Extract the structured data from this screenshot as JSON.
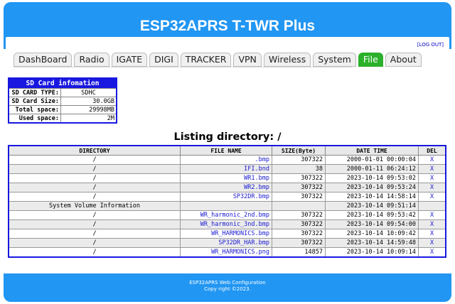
{
  "app": {
    "title": "ESP32APRS T-TWR Plus",
    "logout": "[LOG OUT]"
  },
  "tabs": [
    "DashBoard",
    "Radio",
    "IGATE",
    "DIGI",
    "TRACKER",
    "VPN",
    "Wireless",
    "System",
    "File",
    "About"
  ],
  "active_tab": "File",
  "sdcard": {
    "heading": "SD Card infomation",
    "rows": [
      {
        "label": "SD CARD TYPE:",
        "value": "SDHC"
      },
      {
        "label": "SD Card Size:",
        "value": "30.0GB"
      },
      {
        "label": "Total space:",
        "value": "29998MB"
      },
      {
        "label": "Used space:",
        "value": "2M"
      }
    ]
  },
  "listing": {
    "title": "Listing directory: /"
  },
  "table": {
    "headers": [
      "DIRECTORY",
      "FILE NAME",
      "SIZE(Byte)",
      "DATE TIME",
      "DEL"
    ],
    "rows": [
      {
        "dir": "/",
        "name": ".bmp",
        "size": "307322",
        "date": "2000-01-01 00:00:04",
        "del": "X"
      },
      {
        "dir": "/",
        "name": "IFI.bnd",
        "size": "38",
        "date": "2000-01-11 06:24:12",
        "del": "X"
      },
      {
        "dir": "/",
        "name": "WR1.bmp",
        "size": "307322",
        "date": "2023-10-14 09:53:02",
        "del": "X"
      },
      {
        "dir": "/",
        "name": "WR2.bmp",
        "size": "307322",
        "date": "2023-10-14 09:53:24",
        "del": "X"
      },
      {
        "dir": "/",
        "name": "SP32DR.bmp",
        "size": "307322",
        "date": "2023-10-14 14:58:14",
        "del": "X"
      },
      {
        "dir": "System Volume Information",
        "name": "",
        "size": "",
        "date": "2023-10-14 09:51:14",
        "del": ""
      },
      {
        "dir": "/",
        "name": "WR_harmonic_2nd.bmp",
        "size": "307322",
        "date": "2023-10-14 09:53:42",
        "del": "X"
      },
      {
        "dir": "/",
        "name": "WR_harmonic_3nd.bmp",
        "size": "307322",
        "date": "2023-10-14 09:54:00",
        "del": "X"
      },
      {
        "dir": "/",
        "name": "WR_HARMONICS.bmp",
        "size": "307322",
        "date": "2023-10-14 10:09:42",
        "del": "X"
      },
      {
        "dir": "/",
        "name": "SP32DR_HAR.bmp",
        "size": "307322",
        "date": "2023-10-14 14:59:48",
        "del": "X"
      },
      {
        "dir": "/",
        "name": "WR_HARMONICS.png",
        "size": "14857",
        "date": "2023-10-14 10:09:14",
        "del": "X"
      }
    ]
  },
  "footer": {
    "line1": "ESP32APRS Web Configuration",
    "line2": "Copy right ©2023."
  },
  "colors": {
    "header": "#2196f3",
    "accent": "#1818e0",
    "active_tab": "#2bb02b"
  }
}
